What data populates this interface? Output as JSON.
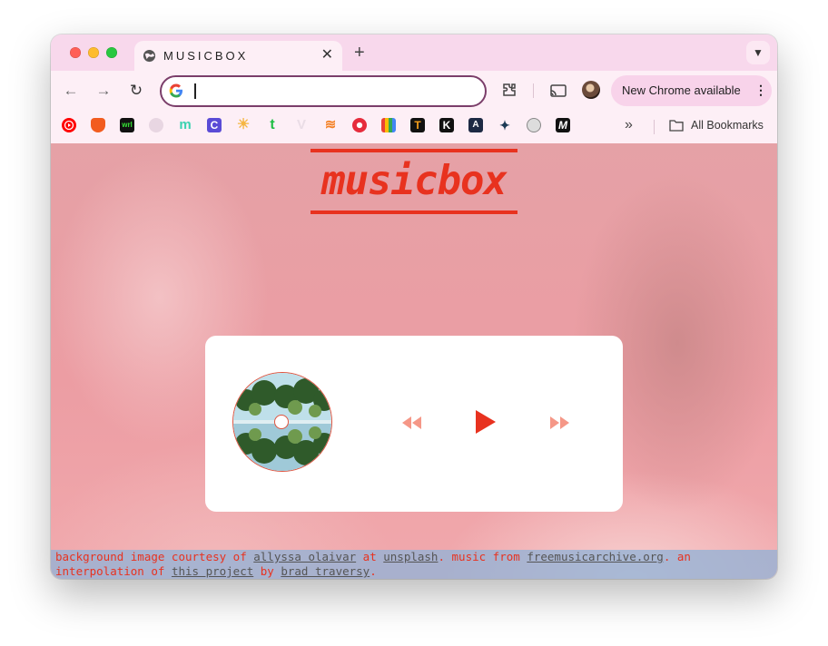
{
  "browser": {
    "tab_title": "MUSICBOX",
    "new_tab_label": "+",
    "address_value": "",
    "update_label": "New Chrome available",
    "bookmarks_all_label": "All Bookmarks",
    "bookmarks": [
      {
        "icon": "youtube-music-icon",
        "color": "#ff0000"
      },
      {
        "icon": "shield-icon",
        "color": "#f25c1f"
      },
      {
        "icon": "wrl-icon",
        "color": "#111111",
        "text": "wrl"
      },
      {
        "icon": "github-icon",
        "color": "#e8d6e2"
      },
      {
        "icon": "m-icon",
        "color": "#3ad2b0",
        "text": "m"
      },
      {
        "icon": "c-icon",
        "color": "#5a4bd6",
        "text": "C"
      },
      {
        "icon": "sun-icon",
        "color": "#f5b642"
      },
      {
        "icon": "t-icon",
        "color": "#1fbe44",
        "text": "t"
      },
      {
        "icon": "v-icon",
        "color": "#eadde6",
        "text": "V"
      },
      {
        "icon": "stack-icon",
        "color": "#f48024"
      },
      {
        "icon": "record-icon",
        "color": "#e62c3c"
      },
      {
        "icon": "books-icon",
        "color": "#3b7bd9"
      },
      {
        "icon": "t-black-icon",
        "color": "#111111",
        "text": "T"
      },
      {
        "icon": "k-icon",
        "color": "#111111",
        "text": "K"
      },
      {
        "icon": "a-icon",
        "color": "#1d2a44",
        "text": "A"
      },
      {
        "icon": "bird-icon",
        "color": "#1b3a55"
      },
      {
        "icon": "lab-icon",
        "color": "#888888"
      },
      {
        "icon": "m-black-icon",
        "color": "#111111",
        "text": "M"
      }
    ]
  },
  "page": {
    "logo": "musicbox",
    "colors": {
      "accent": "#e8321f",
      "footer_bg": "#94b2d6"
    }
  },
  "footer": {
    "t1": "background image courtesy of ",
    "l1": "allyssa olaivar",
    "t2": " at ",
    "l2": "unsplash",
    "t3": ". music from ",
    "l3": "freemusicarchive.org",
    "t4": ". an interpolation of ",
    "l4": "this project",
    "t5": " by ",
    "l5": "brad traversy",
    "t6": "."
  }
}
